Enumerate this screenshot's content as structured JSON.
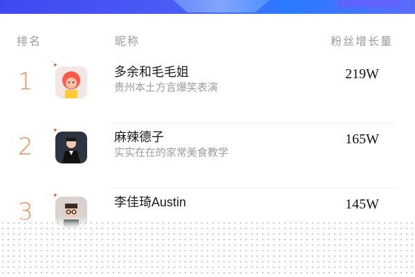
{
  "header": {
    "rank_label": "排名",
    "name_label": "昵称",
    "growth_label": "粉丝增长量"
  },
  "rows": [
    {
      "rank": "1",
      "name": "多余和毛毛姐",
      "desc": "贵州本土方言爆笑表演",
      "growth": "219W",
      "avatar_icon": "avatar-red-hair"
    },
    {
      "rank": "2",
      "name": "麻辣德子",
      "desc": "实实在在的家常美食教学",
      "growth": "165W",
      "avatar_icon": "avatar-man-suit"
    },
    {
      "rank": "3",
      "name": "李佳琦Austin",
      "desc": "",
      "growth": "145W",
      "avatar_icon": "avatar-man-glasses"
    }
  ],
  "colors": {
    "rank": "#f08a53",
    "accent": "#3f49f0"
  }
}
